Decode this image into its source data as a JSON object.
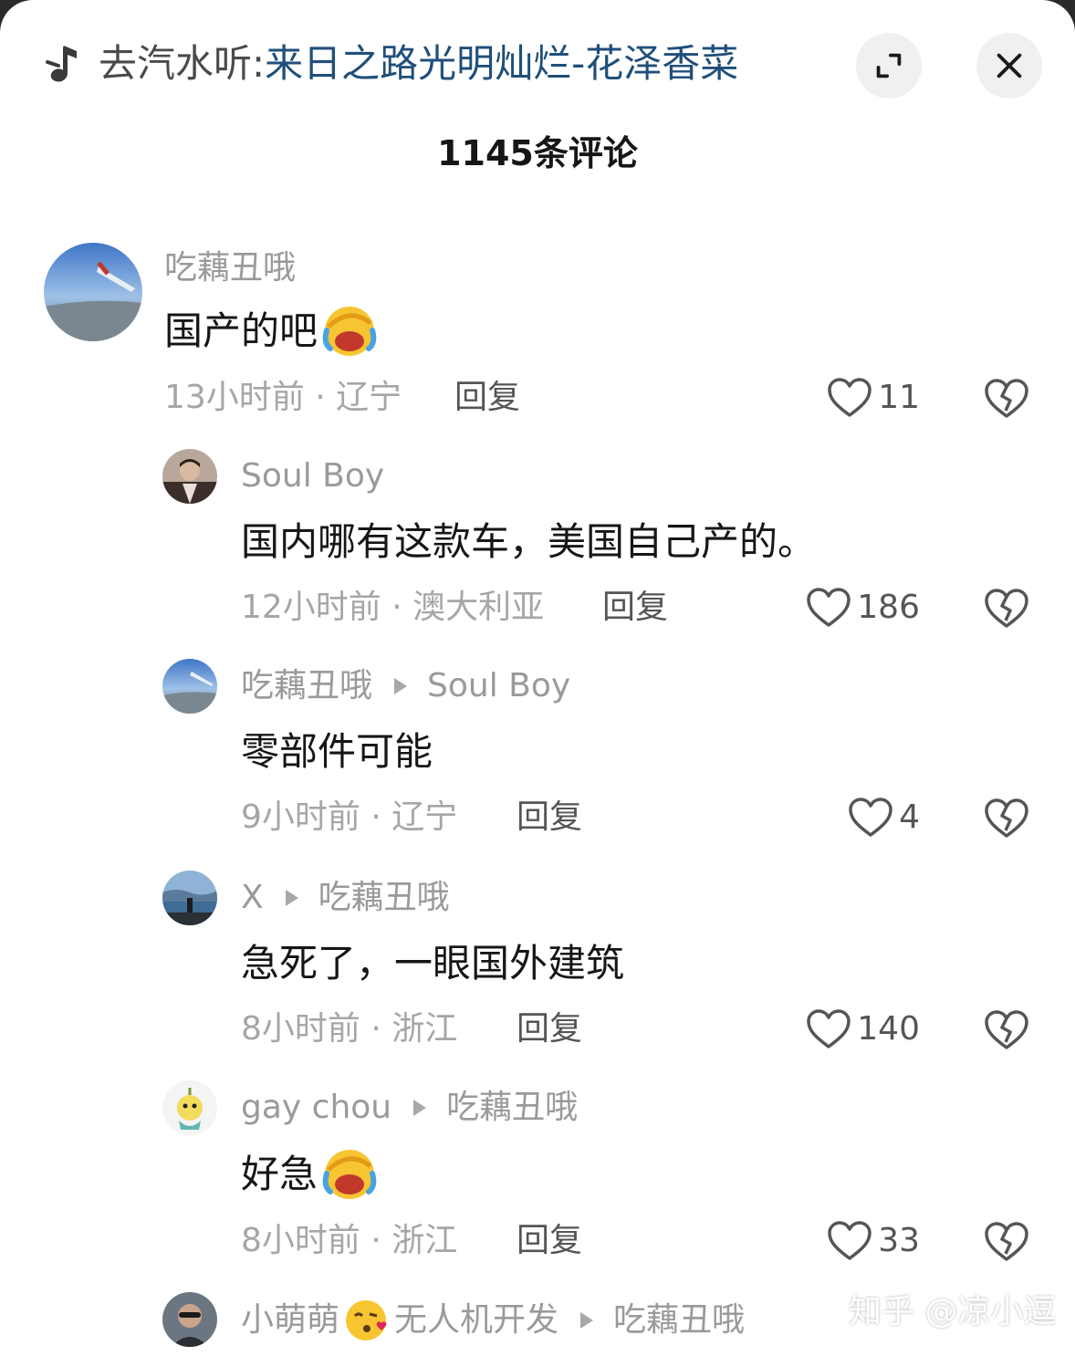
{
  "header": {
    "song_prefix": "去汽水听:",
    "song_title": "来日之路光明灿烂-花泽香菜",
    "comment_count": "1145条评论"
  },
  "comments": [
    {
      "username": "吃藕丑哦",
      "reply_to": "",
      "text": "国产的吧",
      "emoji": "laughing-crying-emoji",
      "time_location": "13小时前 · 辽宁",
      "reply_label": "回复",
      "likes": "11"
    },
    {
      "username": "Soul Boy",
      "reply_to": "",
      "text": "国内哪有这款车，美国自己产的。",
      "time_location": "12小时前 · 澳大利亚",
      "reply_label": "回复",
      "likes": "186"
    },
    {
      "username": "吃藕丑哦",
      "reply_to": "Soul Boy",
      "text": "零部件可能",
      "time_location": "9小时前 · 辽宁",
      "reply_label": "回复",
      "likes": "4"
    },
    {
      "username": "X",
      "reply_to": "吃藕丑哦",
      "text": "急死了，一眼国外建筑",
      "time_location": "8小时前 · 浙江",
      "reply_label": "回复",
      "likes": "140"
    },
    {
      "username": "gay chou",
      "reply_to": "吃藕丑哦",
      "text": "好急",
      "emoji": "laughing-crying-emoji",
      "time_location": "8小时前 · 浙江",
      "reply_label": "回复",
      "likes": "33"
    },
    {
      "username_part1": "小萌萌",
      "username_emoji": "kissing-face-emoji",
      "username_part2": "无人机开发",
      "reply_to": "吃藕丑哦"
    }
  ],
  "watermark": "知乎 @凉小逗",
  "colors": {
    "song_title": "#1f4f7a",
    "meta_gray": "#a6a6a6",
    "username_gray": "#9a9a9a",
    "text": "#161616"
  }
}
